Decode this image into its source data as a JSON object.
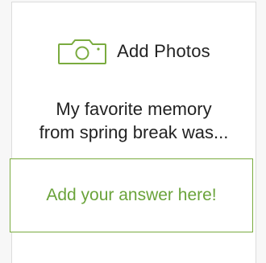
{
  "add_photos": {
    "label": "Add Photos",
    "icon": "camera-icon",
    "icon_color": "#7aab3f"
  },
  "prompt": {
    "line1": "My favorite memory",
    "line2": "from spring break was..."
  },
  "answer": {
    "placeholder": "Add your answer here!",
    "accent_color": "#6aa33a"
  }
}
